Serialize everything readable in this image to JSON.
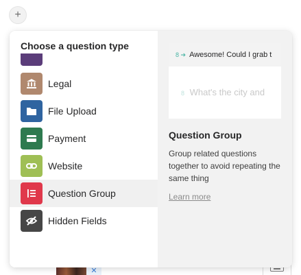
{
  "add_button": {
    "symbol": "+"
  },
  "menu": {
    "heading": "Choose a question type",
    "items": [
      {
        "label": "Legal",
        "icon": "bank-icon",
        "color": "#b0886e",
        "active": false
      },
      {
        "label": "File Upload",
        "icon": "folder-icon",
        "color": "#2f64a0",
        "active": false
      },
      {
        "label": "Payment",
        "icon": "credit-card-icon",
        "color": "#2e7a4f",
        "active": false
      },
      {
        "label": "Website",
        "icon": "link-icon",
        "color": "#9fbf55",
        "active": false
      },
      {
        "label": "Question Group",
        "icon": "list-icon",
        "color": "#e0384b",
        "active": true
      },
      {
        "label": "Hidden Fields",
        "icon": "eye-slash-icon",
        "color": "#464646",
        "active": false
      }
    ]
  },
  "detail": {
    "preview": {
      "question_number": "8",
      "question_text": "Awesome! Could I grab t",
      "field_number": "8",
      "field_placeholder": "What's the city and"
    },
    "title": "Question Group",
    "description": "Group related questions together to avoid repeating the same thing",
    "learn_more": "Learn more"
  },
  "background": {
    "close_symbol": "✕"
  },
  "colors": {
    "accent_teal": "#4cb6a6",
    "active_row": "#f0f0f0",
    "right_pane": "#f2f2f2"
  }
}
